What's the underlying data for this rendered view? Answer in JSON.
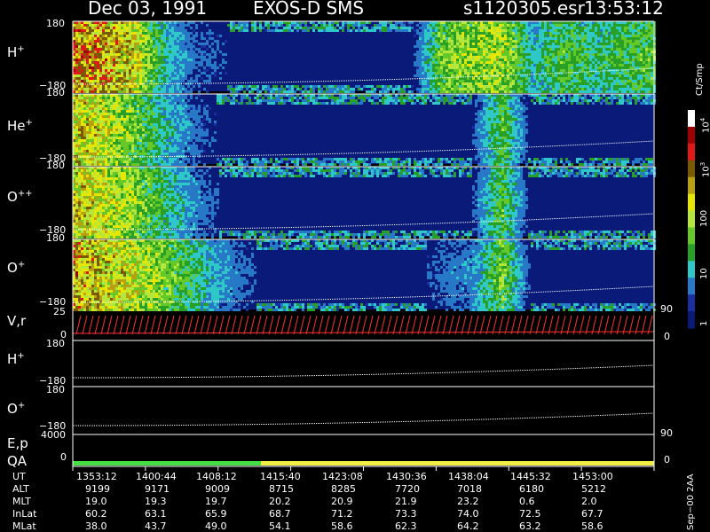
{
  "header": {
    "date": "Dec 03, 1991",
    "mission": "EXOS-D SMS",
    "file": "s1120305.esr",
    "time": "13:53:12"
  },
  "panels": [
    {
      "label_main": "H",
      "label_sup": "+",
      "ymax": "180",
      "ymin": "−180"
    },
    {
      "label_main": "He",
      "label_sup": "+",
      "ymax": "180",
      "ymin": "−180"
    },
    {
      "label_main": "O",
      "label_sup": "++",
      "ymax": "180",
      "ymin": "−180"
    },
    {
      "label_main": "O",
      "label_sup": "+",
      "ymax": "180",
      "ymin": "−180"
    }
  ],
  "line_panels": {
    "vr": {
      "label": "V,r",
      "ymax": "25",
      "ymin": "0",
      "right_top": "90",
      "right_bottom": "0"
    },
    "h_plus": {
      "label_main": "H",
      "label_sup": "+",
      "ymax": "180",
      "ymin": "−180"
    },
    "o_plus": {
      "label_main": "O",
      "label_sup": "+",
      "ymax": "180",
      "ymin": "−180"
    },
    "ep": {
      "label": "E,p",
      "ymax": "4000",
      "ymin": "0",
      "right_top": "90",
      "right_bottom": "0"
    },
    "qa": {
      "label": "QA"
    }
  },
  "colorbar": {
    "units": "Ct/Smp",
    "labels": [
      {
        "base": "10",
        "exp": "4"
      },
      {
        "base": "10",
        "exp": "3"
      },
      {
        "base": "100",
        "exp": ""
      },
      {
        "base": "10",
        "exp": ""
      },
      {
        "base": "1",
        "exp": ""
      }
    ],
    "colors": [
      "#ffffff",
      "#a00000",
      "#e01818",
      "#7a5a00",
      "#b8a010",
      "#e6e600",
      "#b4e63c",
      "#64c828",
      "#28a028",
      "#2ec8c8",
      "#2878c8",
      "#1a30a0",
      "#0a1a78"
    ]
  },
  "footer": {
    "stamp": "Sep−00 2AA",
    "rows": [
      {
        "label": "UT",
        "values": [
          "1353:12",
          "1400:44",
          "1408:12",
          "1415:40",
          "1423:08",
          "1430:36",
          "1438:04",
          "1445:32",
          "1453:00"
        ]
      },
      {
        "label": "ALT",
        "values": [
          "9199",
          "9171",
          "9009",
          "8715",
          "8285",
          "7720",
          "7018",
          "6180",
          "5212"
        ]
      },
      {
        "label": "MLT",
        "values": [
          "19.0",
          "19.3",
          "19.7",
          "20.2",
          "20.9",
          "21.9",
          "23.2",
          "0.6",
          "2.0"
        ]
      },
      {
        "label": "InLat",
        "values": [
          "60.2",
          "63.1",
          "65.9",
          "68.7",
          "71.2",
          "73.3",
          "74.0",
          "72.5",
          "67.7"
        ]
      },
      {
        "label": "MLat",
        "values": [
          "38.0",
          "43.7",
          "49.0",
          "54.1",
          "58.6",
          "62.3",
          "64.2",
          "63.2",
          "58.6"
        ]
      }
    ]
  },
  "chart_data": {
    "type": "heatmap",
    "title": "Dec 03, 1991   EXOS-D SMS",
    "time_axis": [
      "1353:12",
      "1400:44",
      "1408:12",
      "1415:40",
      "1423:08",
      "1430:36",
      "1438:04",
      "1445:32",
      "1453:00"
    ],
    "ylim": [
      -180,
      180
    ],
    "colorbar_label": "Ct/Smp",
    "colorbar_range": [
      1,
      10000
    ],
    "colorbar_scale": "log",
    "series": [
      {
        "name": "H+",
        "activity": [
          0.95,
          0.9,
          0.75,
          0.35,
          0.2,
          0.15,
          0.1,
          0.1,
          0.12,
          0.12,
          0.1,
          0.1,
          0.55,
          0.6,
          0.65,
          0.35,
          0.5,
          0.4,
          0.45,
          0.5
        ]
      },
      {
        "name": "He+",
        "activity": [
          0.8,
          0.7,
          0.55,
          0.35,
          0.2,
          0.12,
          0.08,
          0.08,
          0.08,
          0.08,
          0.08,
          0.08,
          0.12,
          0.15,
          0.5,
          0.1,
          0.08,
          0.08,
          0.08,
          0.08
        ]
      },
      {
        "name": "O++",
        "activity": [
          0.8,
          0.7,
          0.6,
          0.4,
          0.25,
          0.12,
          0.08,
          0.08,
          0.08,
          0.08,
          0.08,
          0.08,
          0.12,
          0.15,
          0.5,
          0.1,
          0.08,
          0.08,
          0.08,
          0.08
        ]
      },
      {
        "name": "O+",
        "activity": [
          0.9,
          0.8,
          0.7,
          0.55,
          0.4,
          0.25,
          0.15,
          0.12,
          0.15,
          0.12,
          0.1,
          0.1,
          0.2,
          0.25,
          0.55,
          0.1,
          0.08,
          0.08,
          0.08,
          0.08
        ]
      }
    ],
    "qa_bar": [
      {
        "color": "#44dd44",
        "until": "1414:30"
      },
      {
        "color": "#eeee44",
        "until": "1453:00"
      }
    ]
  }
}
